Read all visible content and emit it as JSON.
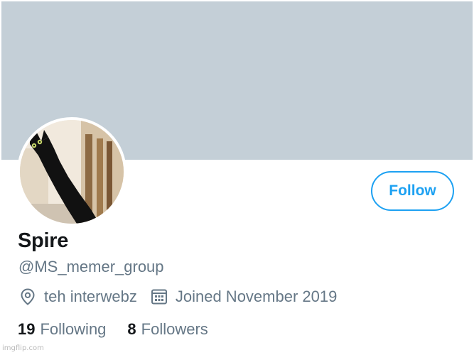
{
  "profile": {
    "display_name": "Spire",
    "handle": "@MS_memer_group",
    "location": "teh interwebz",
    "joined": "Joined November 2019",
    "location_icon": "location-pin-icon",
    "joined_icon": "calendar-icon",
    "avatar_description": "black cat reaching up"
  },
  "actions": {
    "follow_label": "Follow"
  },
  "stats": {
    "following_count": "19",
    "following_label": "Following",
    "followers_count": "8",
    "followers_label": "Followers"
  },
  "watermark": {
    "text": "imgflip.com"
  },
  "colors": {
    "banner": "#c4cfd7",
    "accent": "#1da1f2",
    "primary_text": "#14171a",
    "secondary_text": "#657786"
  }
}
